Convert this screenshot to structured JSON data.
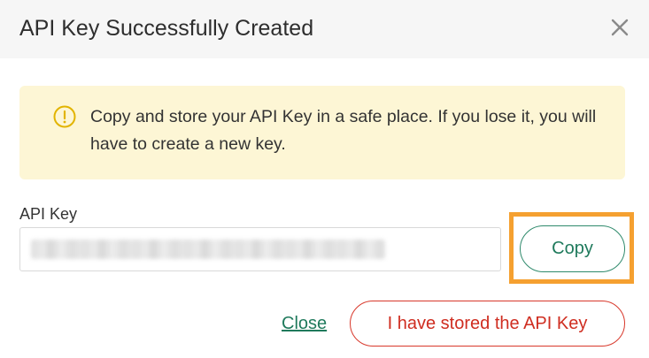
{
  "dialog": {
    "title": "API Key Successfully Created",
    "close_icon": "close-icon"
  },
  "alert": {
    "icon": "warning-circle-icon",
    "message": "Copy and store your API Key in a safe place. If you lose it, you will have to create a new key.",
    "color": "#fdf6d5",
    "icon_color": "#e2b400"
  },
  "api_key": {
    "label": "API Key",
    "value_obscured": true
  },
  "actions": {
    "copy_label": "Copy",
    "close_label": "Close",
    "stored_label": "I have stored the API Key"
  },
  "colors": {
    "primary_green": "#1f7a5c",
    "danger_red": "#cf2d20",
    "highlight_orange": "#f5a030"
  }
}
